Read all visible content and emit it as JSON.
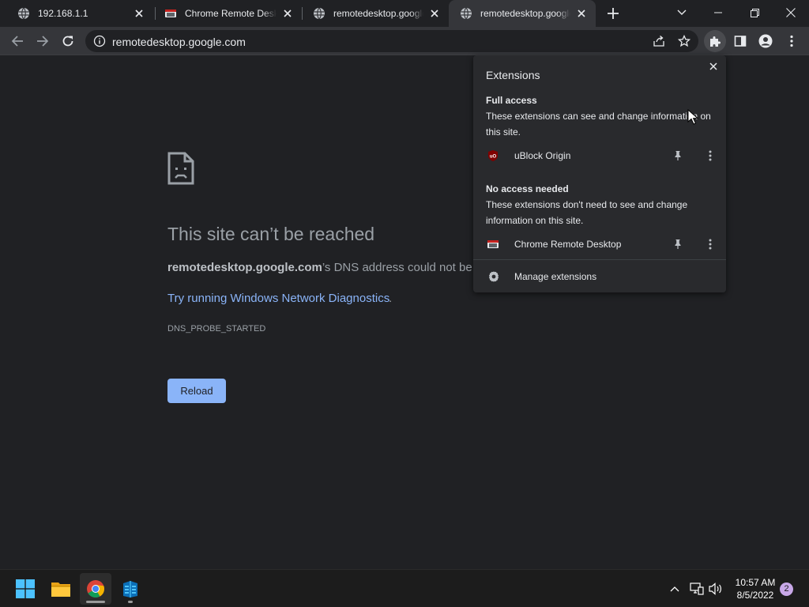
{
  "browser": {
    "tabs": [
      {
        "title": "192.168.1.1",
        "favicon": "globe-icon",
        "active": false
      },
      {
        "title": "Chrome Remote Desktop",
        "favicon": "chrome-remote-desktop-icon",
        "active": false
      },
      {
        "title": "remotedesktop.google.com",
        "favicon": "globe-icon",
        "active": false
      },
      {
        "title": "remotedesktop.google.com",
        "favicon": "globe-icon",
        "active": true
      }
    ],
    "address": {
      "url": "remotedesktop.google.com"
    }
  },
  "error_page": {
    "heading": "This site can’t be reached",
    "domain": "remotedesktop.google.com",
    "detail_suffix": "’s DNS address could not be found.",
    "diagnostics_link": "Try running Windows Network Diagnostics",
    "diagnostics_period": ".",
    "error_code": "DNS_PROBE_STARTED",
    "reload_label": "Reload"
  },
  "extensions_menu": {
    "title": "Extensions",
    "full_access": {
      "heading": "Full access",
      "description": "These extensions can see and change information on this site.",
      "items": [
        {
          "name": "uBlock Origin",
          "icon": "ublock-origin-icon"
        }
      ]
    },
    "no_access": {
      "heading": "No access needed",
      "description": "These extensions don't need to see and change information on this site.",
      "items": [
        {
          "name": "Chrome Remote Desktop",
          "icon": "chrome-remote-desktop-icon"
        }
      ]
    },
    "manage_label": "Manage extensions"
  },
  "taskbar": {
    "apps": [
      "windows-start-icon",
      "file-explorer-icon",
      "chrome-icon",
      "remote-desktop-app-icon"
    ],
    "clock": {
      "time": "10:57 AM",
      "date": "8/5/2022"
    },
    "notification_count": "2"
  },
  "colors": {
    "page_background": "#202124",
    "link": "#8ab4f8",
    "button": "#8ab4f8"
  }
}
